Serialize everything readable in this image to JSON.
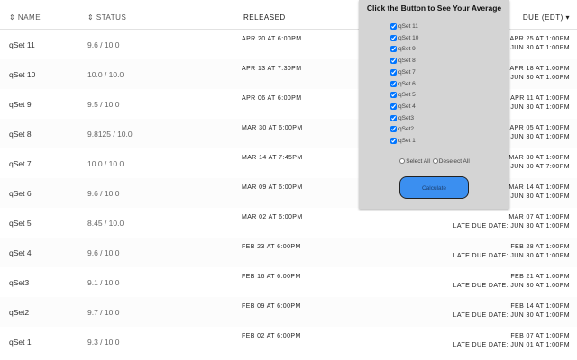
{
  "table": {
    "headers": {
      "name": "⇕ NAME",
      "status": "⇕ STATUS",
      "released": "RELEASED",
      "due": "DUE (EDT) ▾"
    },
    "rows": [
      {
        "name": "qSet 11",
        "status": "9.6 / 10.0",
        "released": "APR 20 AT 6:00PM",
        "due": "APR 25 AT 1:00PM",
        "late": "LATE DUE DATE: JUN 30 AT 1:00PM"
      },
      {
        "name": "qSet 10",
        "status": "10.0 / 10.0",
        "released": "APR 13 AT 7:30PM",
        "due": "APR 18 AT 1:00PM",
        "late": "LATE DUE DATE: JUN 30 AT 1:00PM"
      },
      {
        "name": "qSet 9",
        "status": "9.5 / 10.0",
        "released": "APR 06 AT 6:00PM",
        "due": "APR 11 AT 1:00PM",
        "late": "LATE DUE DATE: JUN 30 AT 1:00PM"
      },
      {
        "name": "qSet 8",
        "status": "9.8125 / 10.0",
        "released": "MAR 30 AT 6:00PM",
        "due": "APR 05 AT 1:00PM",
        "late": "LATE DUE DATE: JUN 30 AT 1:00PM"
      },
      {
        "name": "qSet 7",
        "status": "10.0 / 10.0",
        "released": "MAR 14 AT 7:45PM",
        "due": "MAR 30 AT 1:00PM",
        "late": "LATE DUE DATE: JUN 30 AT 7:00PM"
      },
      {
        "name": "qSet 6",
        "status": "9.6 / 10.0",
        "released": "MAR 09 AT 6:00PM",
        "due": "MAR 14 AT 1:00PM",
        "late": "LATE DUE DATE: JUN 30 AT 1:00PM"
      },
      {
        "name": "qSet 5",
        "status": "8.45 / 10.0",
        "released": "MAR 02 AT 6:00PM",
        "due": "MAR 07 AT 1:00PM",
        "late": "LATE DUE DATE: JUN 30 AT 1:00PM"
      },
      {
        "name": "qSet 4",
        "status": "9.6 / 10.0",
        "released": "FEB 23 AT 6:00PM",
        "due": "FEB 28 AT 1:00PM",
        "late": "LATE DUE DATE: JUN 30 AT 1:00PM"
      },
      {
        "name": "qSet3",
        "status": "9.1 / 10.0",
        "released": "FEB 16 AT 6:00PM",
        "due": "FEB 21 AT 1:00PM",
        "late": "LATE DUE DATE: JUN 30 AT 1:00PM"
      },
      {
        "name": "qSet2",
        "status": "9.7 / 10.0",
        "released": "FEB 09 AT 6:00PM",
        "due": "FEB 14 AT 1:00PM",
        "late": "LATE DUE DATE: JUN 30 AT 1:00PM"
      },
      {
        "name": "qSet 1",
        "status": "9.3 / 10.0",
        "released": "FEB 02 AT 6:00PM",
        "due": "FEB 07 AT 1:00PM",
        "late": "LATE DUE DATE: JUN 01 AT 1:00PM"
      }
    ]
  },
  "panel": {
    "title": "Click the Button to See Your Average",
    "checkboxes": [
      "qSet 11",
      "qSet 10",
      "qSet 9",
      "qSet 8",
      "qSet 7",
      "qSet 6",
      "qSet 5",
      "qSet 4",
      "qSet3",
      "qSet2",
      "qSet 1"
    ],
    "select_all": "Select All",
    "deselect_all": "Deselect All",
    "button": "Calculate",
    "button_color": "#3b8ff0"
  }
}
